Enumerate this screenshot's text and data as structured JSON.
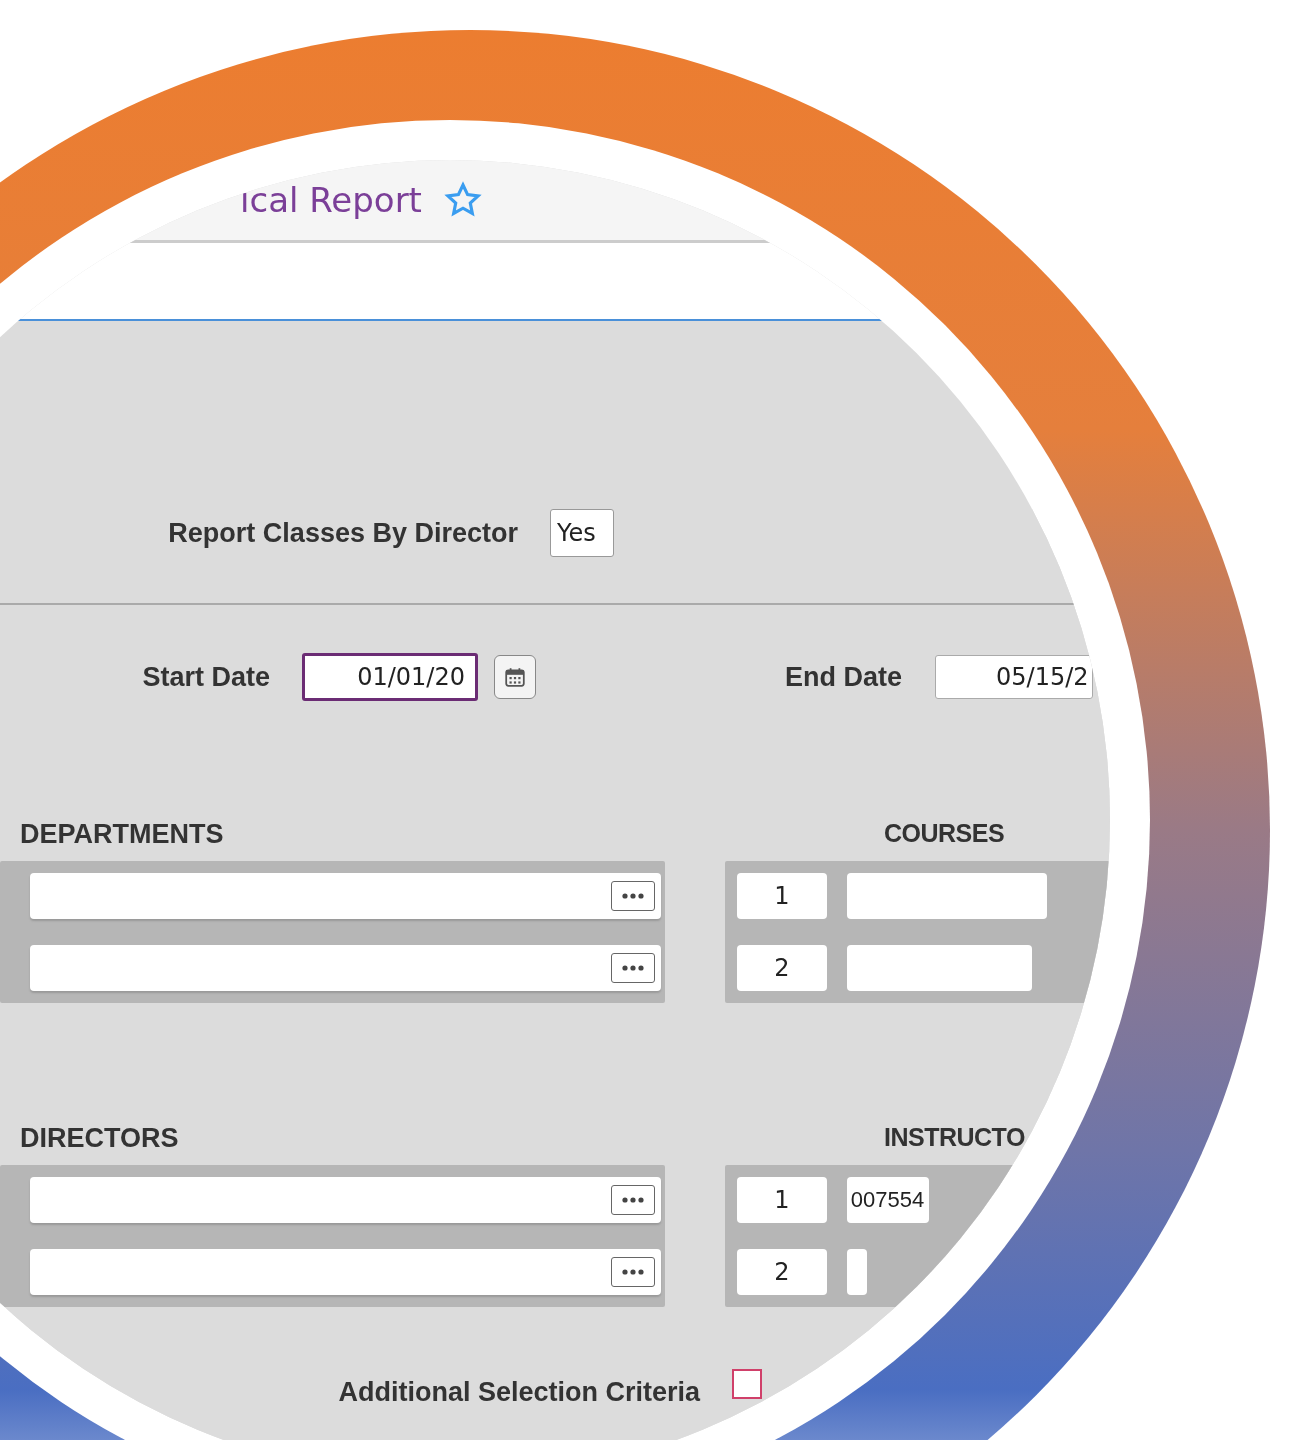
{
  "header": {
    "title": "ical Report",
    "favorite": false
  },
  "report_by_director": {
    "label": "Report Classes By Director",
    "value": "Yes"
  },
  "start_date": {
    "label": "Start Date",
    "value": "01/01/20",
    "focused": true
  },
  "end_date": {
    "label": "End Date",
    "value": "05/15/2",
    "focused": false
  },
  "departments": {
    "heading": "DEPARTMENTS",
    "rows": [
      {
        "kind": "lookup"
      },
      {
        "kind": "lookup"
      }
    ]
  },
  "courses": {
    "heading": "COURSES",
    "rows": [
      {
        "number": "1"
      },
      {
        "number": "2"
      }
    ]
  },
  "directors": {
    "heading": "DIRECTORS",
    "rows": [
      {
        "kind": "lookup"
      },
      {
        "kind": "lookup"
      }
    ]
  },
  "instructors": {
    "heading": "INSTRUCTO",
    "rows": [
      {
        "number": "1",
        "value": "007554"
      },
      {
        "number": "2"
      }
    ]
  },
  "additional_criteria": {
    "label": "Additional Selection Criteria",
    "required": true
  }
}
